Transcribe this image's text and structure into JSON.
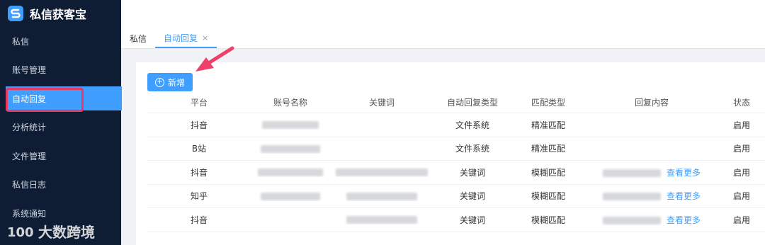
{
  "app": {
    "title": "私信获客宝"
  },
  "sidebar": {
    "items": [
      {
        "label": "私信"
      },
      {
        "label": "账号管理"
      },
      {
        "label": "自动回复"
      },
      {
        "label": "分析统计"
      },
      {
        "label": "文件管理"
      },
      {
        "label": "私信日志"
      },
      {
        "label": "系统通知"
      }
    ],
    "active_index": 2
  },
  "tabs": [
    {
      "label": "私信"
    },
    {
      "label": "自动回复"
    }
  ],
  "tab_close": "×",
  "toolbar": {
    "add_label": "新增"
  },
  "table": {
    "headers": [
      "平台",
      "账号名称",
      "关键词",
      "自动回复类型",
      "匹配类型",
      "回复内容",
      "状态"
    ],
    "rows": [
      {
        "platform": "抖音",
        "reply_type": "文件系统",
        "match_type": "精准匹配",
        "more": "",
        "status": "启用"
      },
      {
        "platform": "B站",
        "reply_type": "文件系统",
        "match_type": "精准匹配",
        "more": "",
        "status": "启用"
      },
      {
        "platform": "抖音",
        "reply_type": "关键词",
        "match_type": "模糊匹配",
        "more": "查看更多",
        "status": "启用"
      },
      {
        "platform": "知乎",
        "reply_type": "关键词",
        "match_type": "模糊匹配",
        "more": "查看更多",
        "status": "启用"
      },
      {
        "platform": "抖音",
        "reply_type": "关键词",
        "match_type": "模糊匹配",
        "more": "查看更多",
        "status": "启用"
      }
    ]
  },
  "watermark": {
    "text": "大数跨境",
    "logo_text": "100"
  },
  "colors": {
    "sidebar_bg": "#0f1d34",
    "accent": "#409eff",
    "highlight": "#e63a63"
  }
}
